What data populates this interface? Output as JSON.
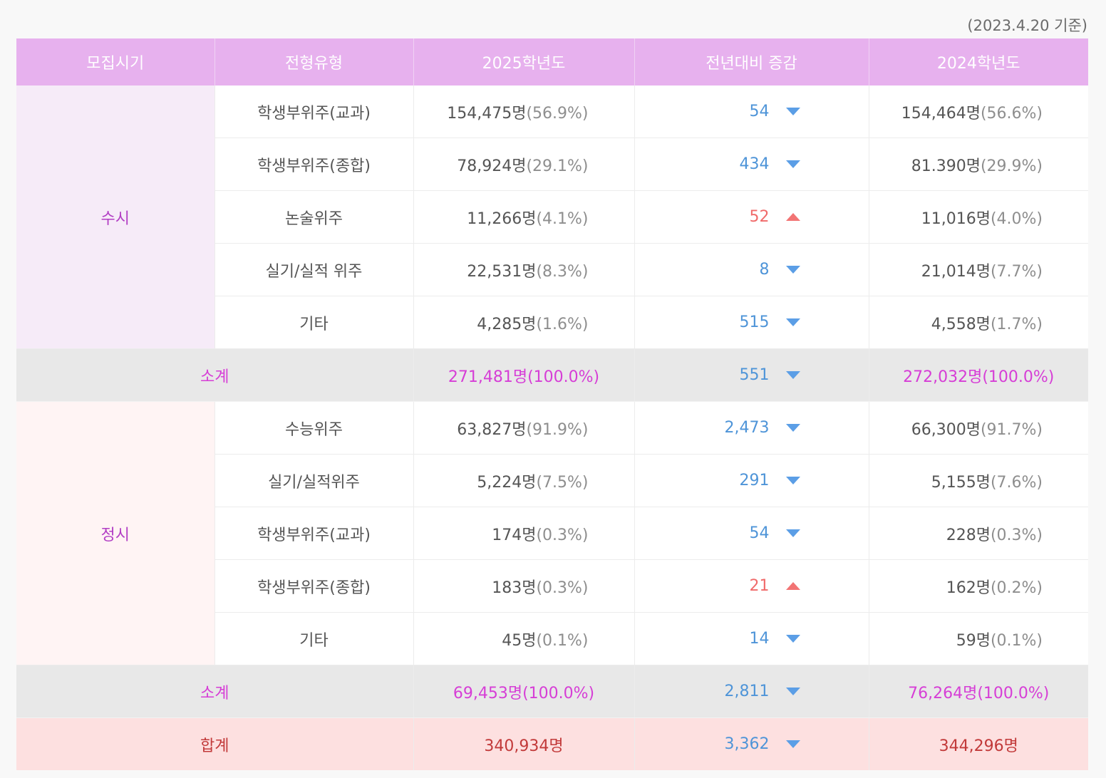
{
  "note": "(2023.4.20 기준)",
  "headers": {
    "period": "모집시기",
    "type": "전형유형",
    "y2025": "2025학년도",
    "change": "전년대비 증감",
    "y2024": "2024학년도"
  },
  "susi": {
    "label": "수시",
    "rows": [
      {
        "type": "학생부위주(교과)",
        "c2025": "154,475명",
        "p2025": "(56.9%)",
        "change": "54",
        "dir": "down",
        "c2024": "154,464명",
        "p2024": "(56.6%)"
      },
      {
        "type": "학생부위주(종합)",
        "c2025": "78,924명",
        "p2025": "(29.1%)",
        "change": "434",
        "dir": "down",
        "c2024": "81.390명",
        "p2024": "(29.9%)"
      },
      {
        "type": "논술위주",
        "c2025": "11,266명",
        "p2025": "(4.1%)",
        "change": "52",
        "dir": "up",
        "c2024": "11,016명",
        "p2024": "(4.0%)"
      },
      {
        "type": "실기/실적 위주",
        "c2025": "22,531명",
        "p2025": "(8.3%)",
        "change": "8",
        "dir": "down",
        "c2024": "21,014명",
        "p2024": "(7.7%)"
      },
      {
        "type": "기타",
        "c2025": "4,285명",
        "p2025": "(1.6%)",
        "change": "515",
        "dir": "down",
        "c2024": "4,558명",
        "p2024": "(1.7%)"
      }
    ],
    "subtotal": {
      "label": "소계",
      "c2025": "271,481명",
      "p2025": "(100.0%)",
      "change": "551",
      "dir": "down",
      "c2024": "272,032명",
      "p2024": "(100.0%)"
    }
  },
  "jeongsi": {
    "label": "정시",
    "rows": [
      {
        "type": "수능위주",
        "c2025": "63,827명",
        "p2025": "(91.9%)",
        "change": "2,473",
        "dir": "down",
        "c2024": "66,300명",
        "p2024": "(91.7%)"
      },
      {
        "type": "실기/실적위주",
        "c2025": "5,224명",
        "p2025": "(7.5%)",
        "change": "291",
        "dir": "down",
        "c2024": "5,155명",
        "p2024": "(7.6%)"
      },
      {
        "type": "학생부위주(교과)",
        "c2025": "174명",
        "p2025": "(0.3%)",
        "change": "54",
        "dir": "down",
        "c2024": "228명",
        "p2024": "(0.3%)"
      },
      {
        "type": "학생부위주(종합)",
        "c2025": "183명",
        "p2025": "(0.3%)",
        "change": "21",
        "dir": "up",
        "c2024": "162명",
        "p2024": "(0.2%)"
      },
      {
        "type": "기타",
        "c2025": "45명",
        "p2025": "(0.1%)",
        "change": "14",
        "dir": "down",
        "c2024": "59명",
        "p2024": "(0.1%)"
      }
    ],
    "subtotal": {
      "label": "소계",
      "c2025": "69,453명",
      "p2025": "(100.0%)",
      "change": "2,811",
      "dir": "down",
      "c2024": "76,264명",
      "p2024": "(100.0%)"
    }
  },
  "total": {
    "label": "합계",
    "c2025": "340,934명",
    "change": "3,362",
    "dir": "down",
    "c2024": "344,296명"
  },
  "colors": {
    "header_bg": "#e7b1ee",
    "susi_bg": "#f6ebf8",
    "jeongsi_bg": "#fff4f4",
    "subtotal_text": "#d63ed6",
    "total_bg": "#fde0e0",
    "total_text": "#c23a3a",
    "decrease": "#4e94d8",
    "increase": "#f06a6a"
  }
}
